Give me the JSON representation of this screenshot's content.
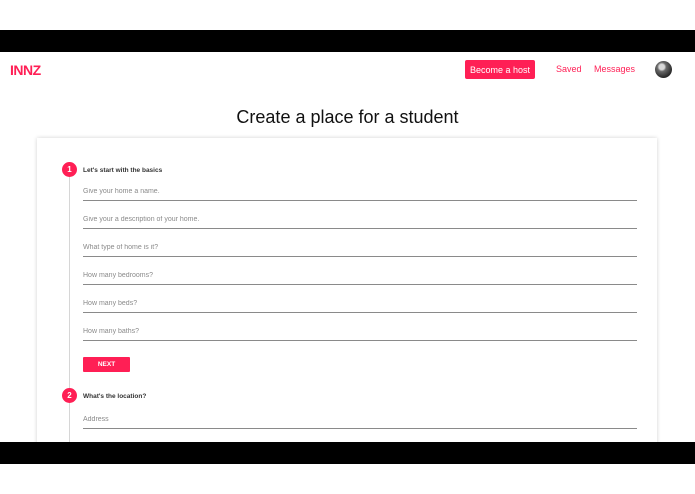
{
  "theme": {
    "accent": "#ff1f55",
    "text": "#111111"
  },
  "header": {
    "logo": "INNZ",
    "become_host": "Become a host",
    "saved": "Saved",
    "messages": "Messages",
    "avatar": "user-avatar"
  },
  "page": {
    "title": "Create a place for a student"
  },
  "steps": [
    {
      "number": "1",
      "title": "Let's start with the basics",
      "fields": [
        {
          "placeholder": "Give your home a name.",
          "value": ""
        },
        {
          "placeholder": "Give your a description of your home.",
          "value": ""
        },
        {
          "placeholder": "What type of home is it?",
          "value": ""
        },
        {
          "placeholder": "How many bedrooms?",
          "value": ""
        },
        {
          "placeholder": "How many beds?",
          "value": ""
        },
        {
          "placeholder": "How many baths?",
          "value": ""
        }
      ],
      "next_label": "NEXT"
    },
    {
      "number": "2",
      "title": "What's the location?",
      "fields": [
        {
          "placeholder": "Address",
          "value": ""
        }
      ]
    }
  ]
}
